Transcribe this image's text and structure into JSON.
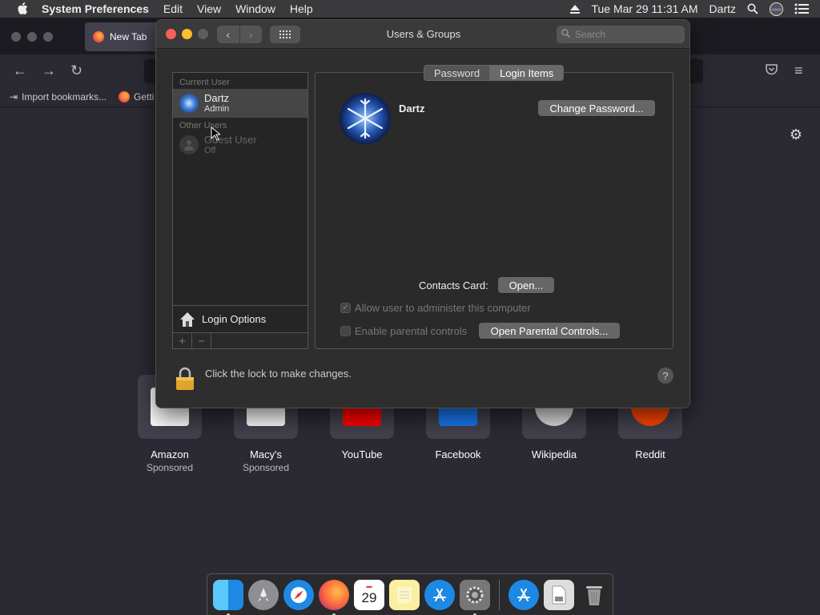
{
  "menubar": {
    "app_name": "System Preferences",
    "menus": [
      "Edit",
      "View",
      "Window",
      "Help"
    ],
    "datetime": "Tue Mar 29  11:31 AM",
    "user": "Dartz"
  },
  "firefox": {
    "tab_title": "New Tab",
    "bookmarks": [
      "Import bookmarks...",
      "Getti"
    ],
    "top_sites": [
      {
        "name": "Amazon",
        "sub": "Sponsored",
        "color": "#ffffff"
      },
      {
        "name": "Macy's",
        "sub": "Sponsored",
        "color": "#ffffff"
      },
      {
        "name": "YouTube",
        "sub": "",
        "color": "#ff0000"
      },
      {
        "name": "Facebook",
        "sub": "",
        "color": "#1877f2"
      },
      {
        "name": "Wikipedia",
        "sub": "",
        "color": "#dddddd"
      },
      {
        "name": "Reddit",
        "sub": "",
        "color": "#ff4500"
      }
    ]
  },
  "window": {
    "title": "Users & Groups",
    "search_placeholder": "Search"
  },
  "users": {
    "current_header": "Current User",
    "current_name": "Dartz",
    "current_role": "Admin",
    "other_header": "Other Users",
    "guest_name": "Guest User",
    "guest_status": "Off",
    "login_options": "Login Options",
    "add": "+",
    "remove": "−"
  },
  "panel": {
    "tabs": [
      "Password",
      "Login Items"
    ],
    "name": "Dartz",
    "change_password": "Change Password...",
    "contacts_label": "Contacts Card:",
    "open_button": "Open...",
    "allow_admin": "Allow user to administer this computer",
    "parental": "Enable parental controls",
    "open_parental": "Open Parental Controls..."
  },
  "footer": {
    "lock_text": "Click the lock to make changes.",
    "help": "?"
  }
}
